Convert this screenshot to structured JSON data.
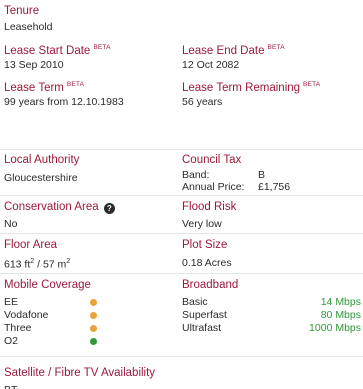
{
  "tenure": {
    "label": "Tenure",
    "value": "Leasehold"
  },
  "beta_tag": "BETA",
  "lease_start": {
    "label": "Lease Start Date",
    "value": "13 Sep 2010"
  },
  "lease_end": {
    "label": "Lease End Date",
    "value": "12 Oct 2082"
  },
  "lease_term": {
    "label": "Lease Term",
    "value": "99 years from 12.10.1983"
  },
  "lease_remaining": {
    "label": "Lease Term Remaining",
    "value": "56 years"
  },
  "local_authority": {
    "label": "Local Authority",
    "value": "Gloucestershire"
  },
  "council_tax": {
    "label": "Council Tax",
    "band_label": "Band:",
    "band_value": "B",
    "price_label": "Annual Price:",
    "price_value": "£1,756"
  },
  "conservation": {
    "label": "Conservation Area",
    "value": "No",
    "icon": "question-icon"
  },
  "flood_risk": {
    "label": "Flood Risk",
    "value": "Very low"
  },
  "floor_area": {
    "label": "Floor Area",
    "value_ft": "613 ft",
    "exp": "2",
    "value_m": " / 57 m"
  },
  "plot_size": {
    "label": "Plot Size",
    "value": "0.18 Acres"
  },
  "mobile": {
    "label": "Mobile Coverage",
    "colors": {
      "amber": "#e8a33a",
      "green": "#2f9a3a"
    },
    "networks": [
      {
        "name": "EE",
        "status": "amber"
      },
      {
        "name": "Vodafone",
        "status": "amber"
      },
      {
        "name": "Three",
        "status": "amber"
      },
      {
        "name": "O2",
        "status": "green"
      }
    ]
  },
  "broadband": {
    "label": "Broadband",
    "tiers": [
      {
        "name": "Basic",
        "speed": "14 Mbps"
      },
      {
        "name": "Superfast",
        "speed": "80 Mbps"
      },
      {
        "name": "Ultrafast",
        "speed": "1000 Mbps"
      }
    ]
  },
  "satellite": {
    "label": "Satellite / Fibre TV Availability",
    "value": "BT"
  },
  "colors": {
    "label": "#9b1b3c",
    "text": "#2b2b2b",
    "divider": "#e6e6e6"
  }
}
